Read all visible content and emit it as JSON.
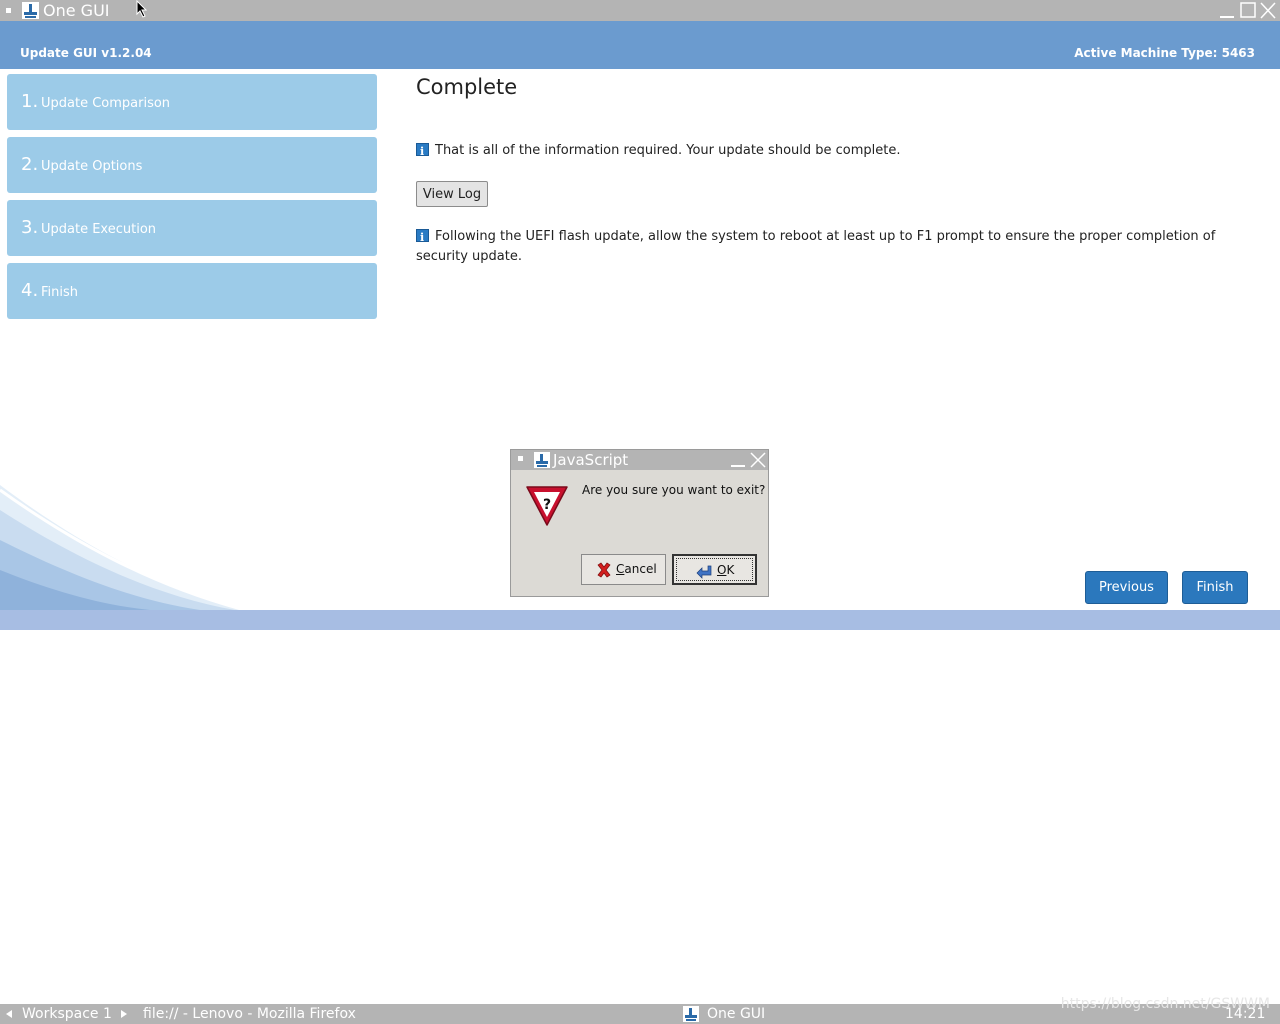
{
  "window": {
    "title": "One GUI"
  },
  "header": {
    "version": "Update GUI v1.2.04",
    "machine_type": "Active Machine Type: 5463"
  },
  "steps": [
    {
      "num": "1.",
      "label": "Update Comparison"
    },
    {
      "num": "2.",
      "label": "Update Options"
    },
    {
      "num": "3.",
      "label": "Update Execution"
    },
    {
      "num": "4.",
      "label": "Finish"
    }
  ],
  "main": {
    "title": "Complete",
    "info1": "That is all of the information required. Your update should be complete.",
    "view_log": "View Log",
    "info2_line1": "Following the UEFI flash update, allow the system to reboot at least up to F1 prompt to ensure the proper completion of",
    "info2_line2": "security update."
  },
  "nav": {
    "previous": "Previous",
    "finish": "Finish"
  },
  "dialog": {
    "title": "JavaScript",
    "message": "Are you sure you want to exit?",
    "cancel_mnemonic": "C",
    "cancel_rest": "ancel",
    "ok_mnemonic": "O",
    "ok_rest": "K"
  },
  "taskbar": {
    "workspace": "Workspace 1",
    "window_item": "file:// - Lenovo - Mozilla Firefox",
    "app_item": "One GUI",
    "clock": "14:21"
  },
  "watermark": "https://blog.csdn.net/GSWWM",
  "colors": {
    "header_bg": "#6b9bcf",
    "step_bg": "#9ccbe8",
    "button_primary": "#2b78bd",
    "titlebar": "#b4b4b4",
    "band": "#a7bde3"
  }
}
